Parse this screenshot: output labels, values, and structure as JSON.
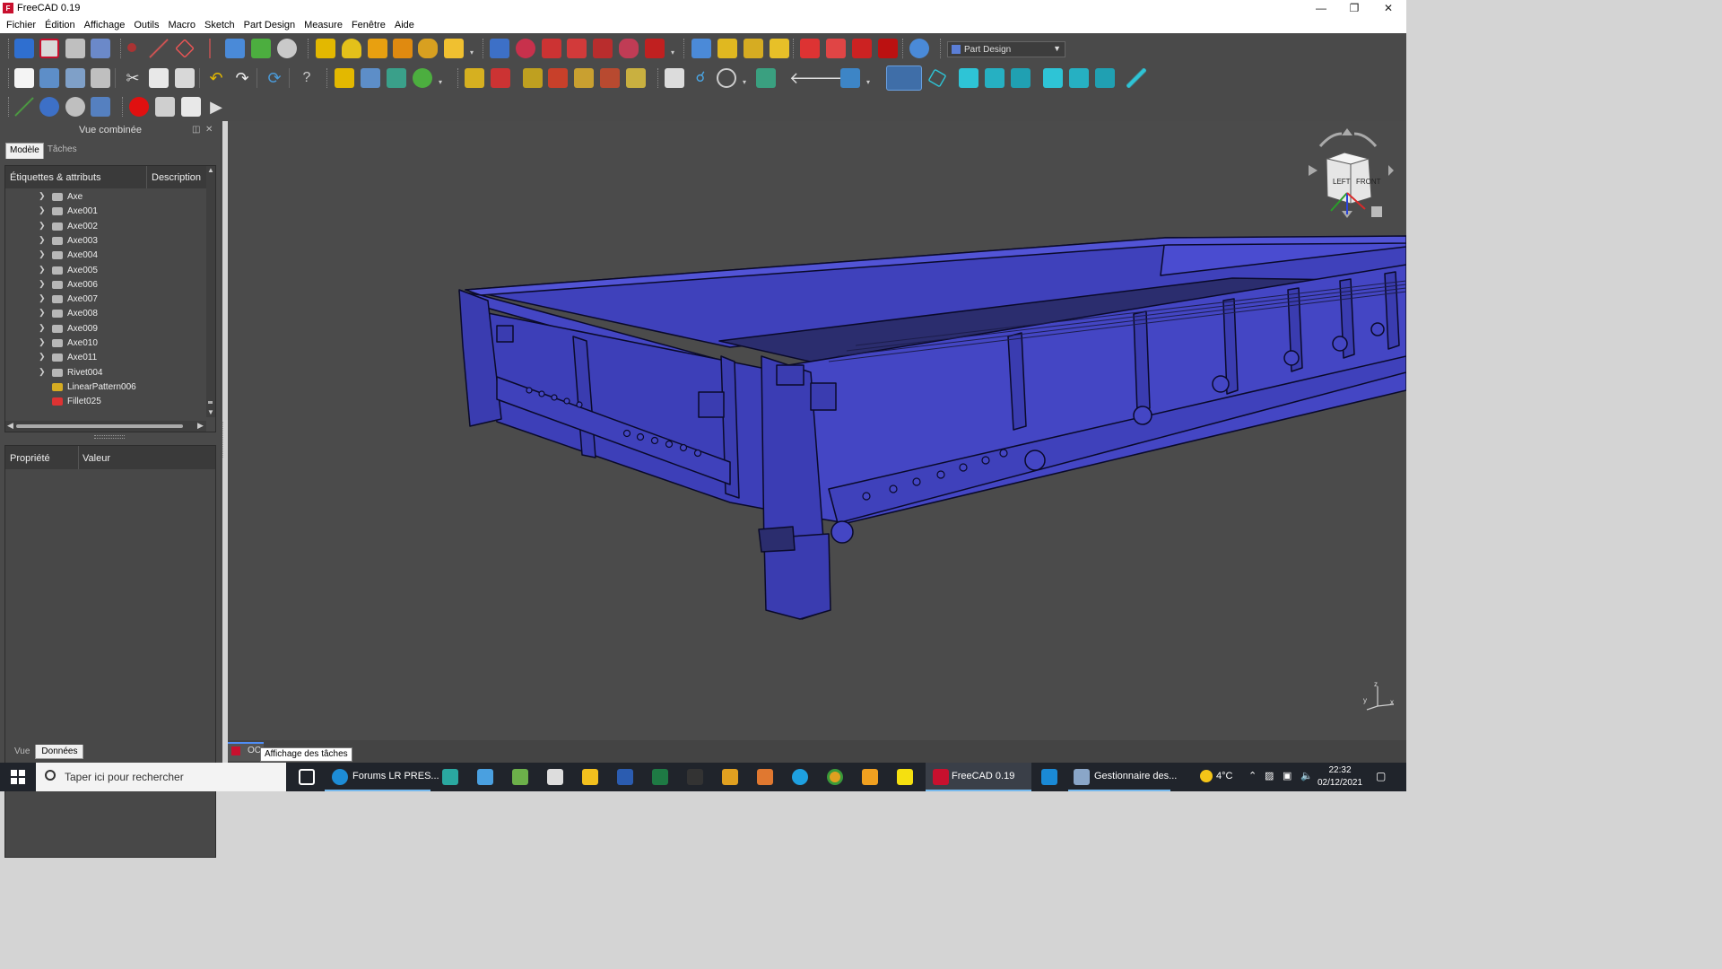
{
  "window": {
    "title": "FreeCAD 0.19",
    "app_icon": "freecad-icon"
  },
  "menu": [
    "Fichier",
    "Édition",
    "Affichage",
    "Outils",
    "Macro",
    "Sketch",
    "Part Design",
    "Measure",
    "Fenêtre",
    "Aide"
  ],
  "workbench": {
    "selected": "Part Design"
  },
  "combo_view": {
    "title": "Vue combinée",
    "tabs": [
      "Modèle",
      "Tâches"
    ],
    "tree_headers": [
      "Étiquettes & attributs",
      "Description"
    ],
    "tree_items": [
      {
        "label": "Axe",
        "icon": "body-icon",
        "expandable": true
      },
      {
        "label": "Axe001",
        "icon": "body-icon",
        "expandable": true
      },
      {
        "label": "Axe002",
        "icon": "body-icon",
        "expandable": true
      },
      {
        "label": "Axe003",
        "icon": "body-icon",
        "expandable": true
      },
      {
        "label": "Axe004",
        "icon": "body-icon",
        "expandable": true
      },
      {
        "label": "Axe005",
        "icon": "body-icon",
        "expandable": true
      },
      {
        "label": "Axe006",
        "icon": "body-icon",
        "expandable": true
      },
      {
        "label": "Axe007",
        "icon": "body-icon",
        "expandable": true
      },
      {
        "label": "Axe008",
        "icon": "body-icon",
        "expandable": true
      },
      {
        "label": "Axe009",
        "icon": "body-icon",
        "expandable": true
      },
      {
        "label": "Axe010",
        "icon": "body-icon",
        "expandable": true
      },
      {
        "label": "Axe011",
        "icon": "body-icon",
        "expandable": true
      },
      {
        "label": "Rivet004",
        "icon": "body-icon",
        "expandable": true
      },
      {
        "label": "LinearPattern006",
        "icon": "linear-pattern-icon",
        "expandable": false
      },
      {
        "label": "Fillet025",
        "icon": "fillet-icon",
        "expandable": false
      }
    ],
    "prop_headers": [
      "Propriété",
      "Valeur"
    ],
    "bottom_tabs": [
      "Vue",
      "Données"
    ],
    "active_bottom_tab": "Données"
  },
  "navcube": {
    "faces": [
      "LEFT",
      "FRONT"
    ]
  },
  "mdi": {
    "tab_label": "OC",
    "tooltip": "Affichage des tâches"
  },
  "taskbar": {
    "search_placeholder": "Taper ici pour rechercher",
    "apps": [
      {
        "name": "edge",
        "label": "Forums LR PRES..."
      },
      {
        "name": "freecad",
        "label": "FreeCAD 0.19"
      },
      {
        "name": "task-manager",
        "label": "Gestionnaire des..."
      }
    ],
    "weather": "4°C",
    "time": "22:32",
    "date": "02/12/2021"
  },
  "colors": {
    "model_face": "#4547c8",
    "model_edge": "#0a0a2a",
    "view_bg": "#4b4b4b",
    "toolbar_bg": "#4a4a4a",
    "accent": "#4f8df6"
  }
}
